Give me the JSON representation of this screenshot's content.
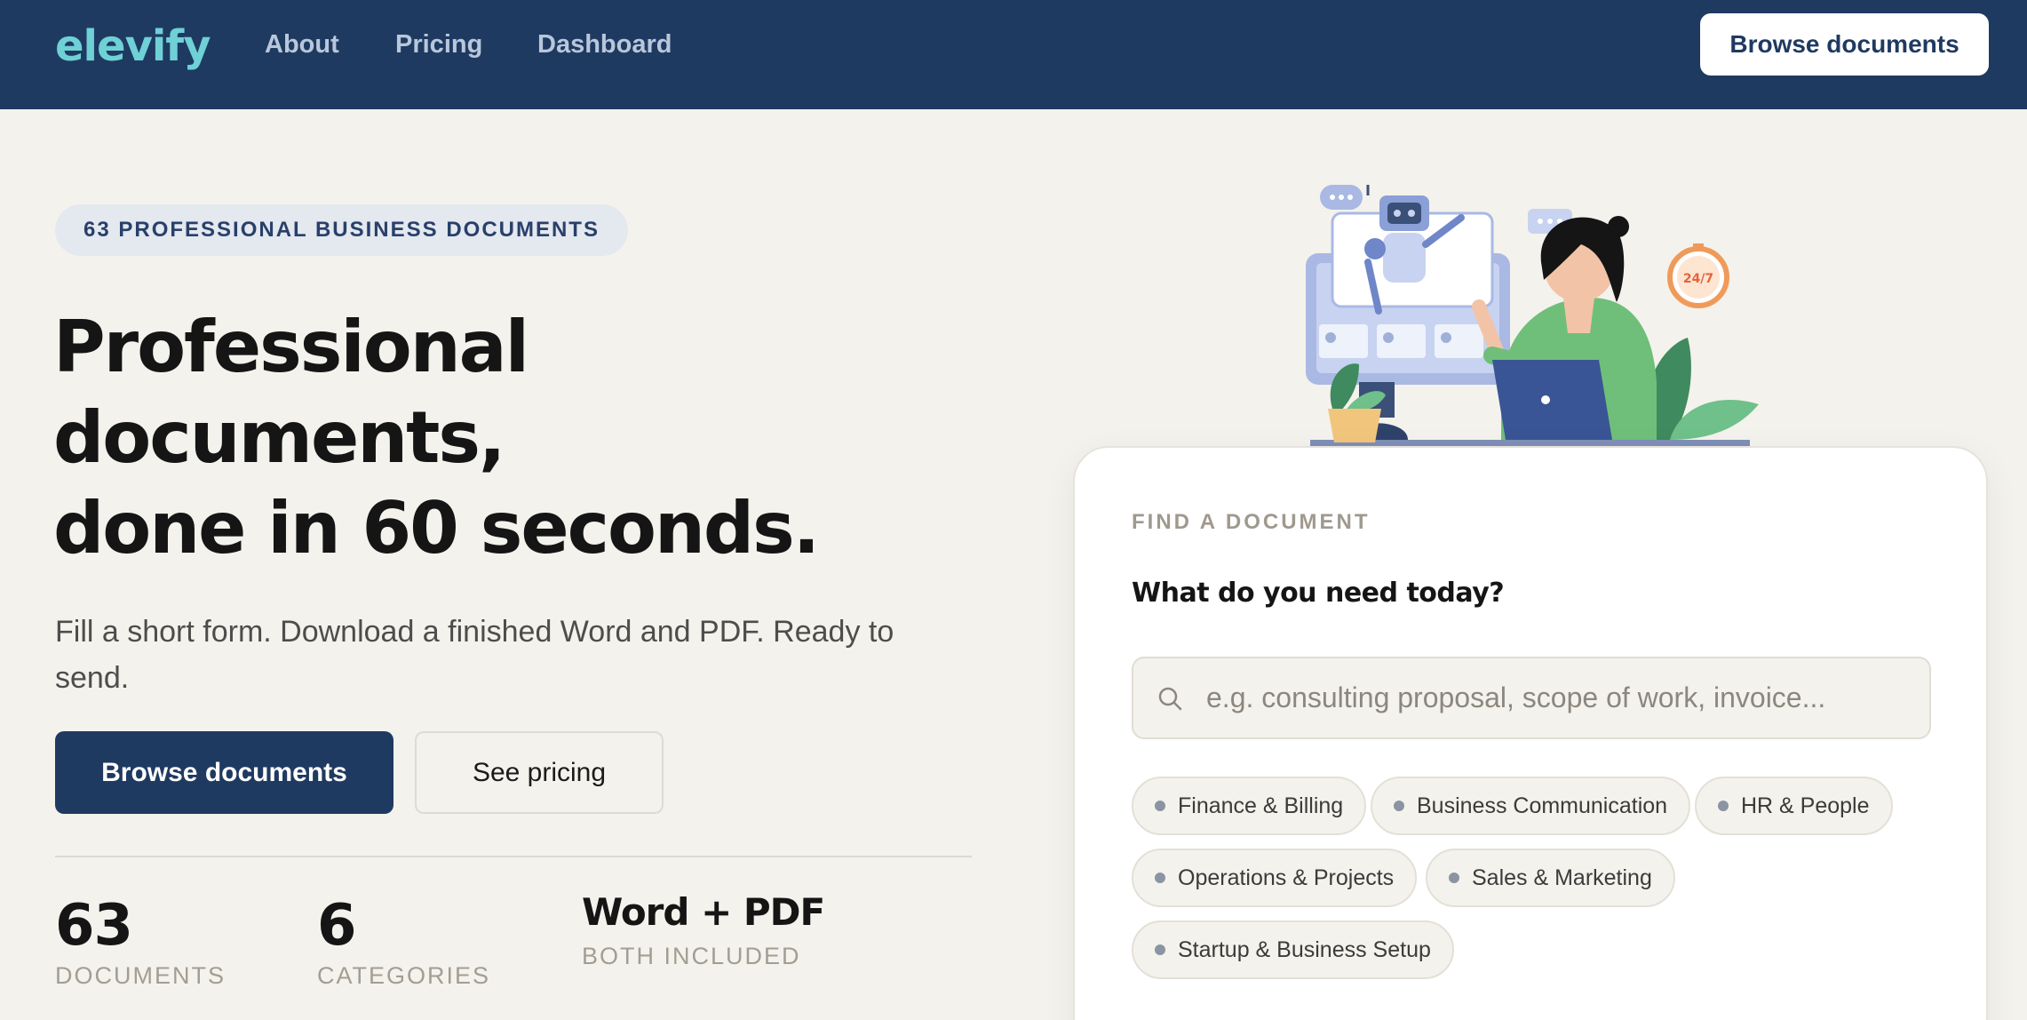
{
  "nav": {
    "logo": "elevify",
    "links": [
      "About",
      "Pricing",
      "Dashboard"
    ],
    "cta": "Browse documents"
  },
  "hero": {
    "pill": "63 PROFESSIONAL BUSINESS DOCUMENTS",
    "headline": [
      "Professional",
      "documents,",
      "done in 60 seconds."
    ],
    "subtext": "Fill a short form. Download a finished Word and PDF. Ready to send.",
    "primary_button": "Browse documents",
    "secondary_button": "See pricing",
    "stats": [
      {
        "value": "63",
        "label": "DOCUMENTS"
      },
      {
        "value": "6",
        "label": "CATEGORIES"
      },
      {
        "value": "Word + PDF",
        "label": "BOTH INCLUDED"
      }
    ]
  },
  "illustration": {
    "clock_text": "24/7"
  },
  "finder": {
    "eyebrow": "FIND A DOCUMENT",
    "title": "What do you need today?",
    "search_placeholder": "e.g. consulting proposal, scope of work, invoice...",
    "categories": [
      "Finance & Billing",
      "Business Communication",
      "HR & People",
      "Operations & Projects",
      "Sales & Marketing",
      "Startup & Business Setup"
    ]
  },
  "colors": {
    "nav_bg": "#1f3a61",
    "logo": "#6fd0d6",
    "page_bg": "#f4f2ec",
    "primary": "#1f3a61"
  }
}
